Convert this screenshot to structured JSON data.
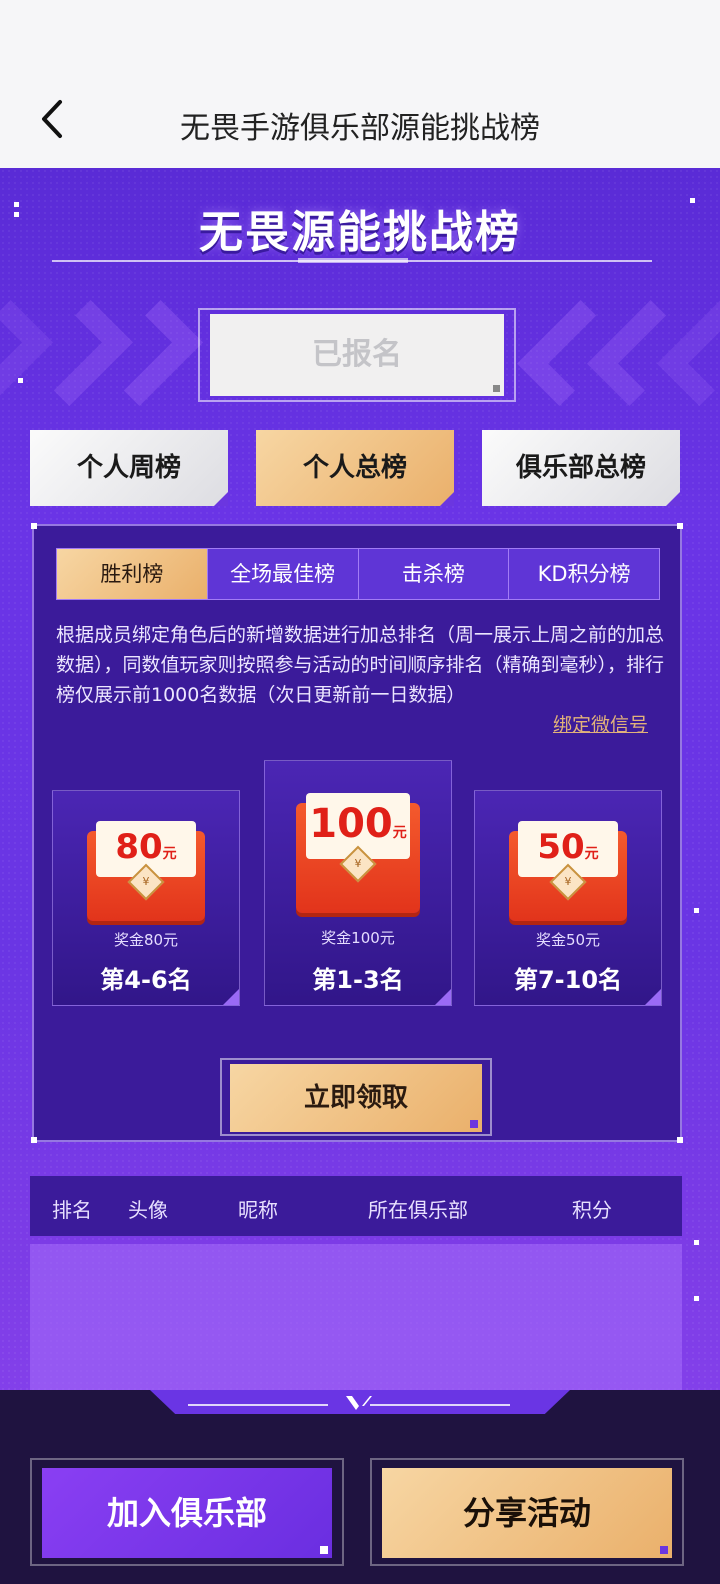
{
  "nav": {
    "title": "无畏手游俱乐部源能挑战榜"
  },
  "hero": {
    "title": "无畏源能挑战榜"
  },
  "signup": {
    "label": "已报名"
  },
  "boards": [
    {
      "label": "个人周榜",
      "active": false
    },
    {
      "label": "个人总榜",
      "active": true
    },
    {
      "label": "俱乐部总榜",
      "active": false
    }
  ],
  "subtabs": [
    {
      "label": "胜利榜",
      "active": true
    },
    {
      "label": "全场最佳榜",
      "active": false
    },
    {
      "label": "击杀榜",
      "active": false
    },
    {
      "label": "KD积分榜",
      "active": false
    }
  ],
  "description": "根据成员绑定角色后的新增数据进行加总排名（周一展示上周之前的加总数据），同数值玩家则按照参与活动的时间顺序排名（精确到毫秒），排行榜仅展示前1000名数据（次日更新前一日数据）",
  "bind_link": "绑定微信号",
  "prizes": {
    "left": {
      "value": "80",
      "unit": "元",
      "amount": "奖金80元",
      "rank": "第4-6名"
    },
    "center": {
      "value": "100",
      "unit": "元",
      "amount": "奖金100元",
      "rank": "第1-3名"
    },
    "right": {
      "value": "50",
      "unit": "元",
      "amount": "奖金50元",
      "rank": "第7-10名"
    },
    "seal_symbol": "¥"
  },
  "claim_button": "立即领取",
  "table": {
    "headers": {
      "rank": "排名",
      "avatar": "头像",
      "nickname": "昵称",
      "club": "所在俱乐部",
      "score": "积分"
    },
    "rows": []
  },
  "footer": {
    "join": "加入俱乐部",
    "share": "分享活动"
  },
  "colors": {
    "purple": "#6a35e4",
    "gold": "#eab06b",
    "dark": "#1f1340",
    "red_envelope": "#e2341b"
  }
}
